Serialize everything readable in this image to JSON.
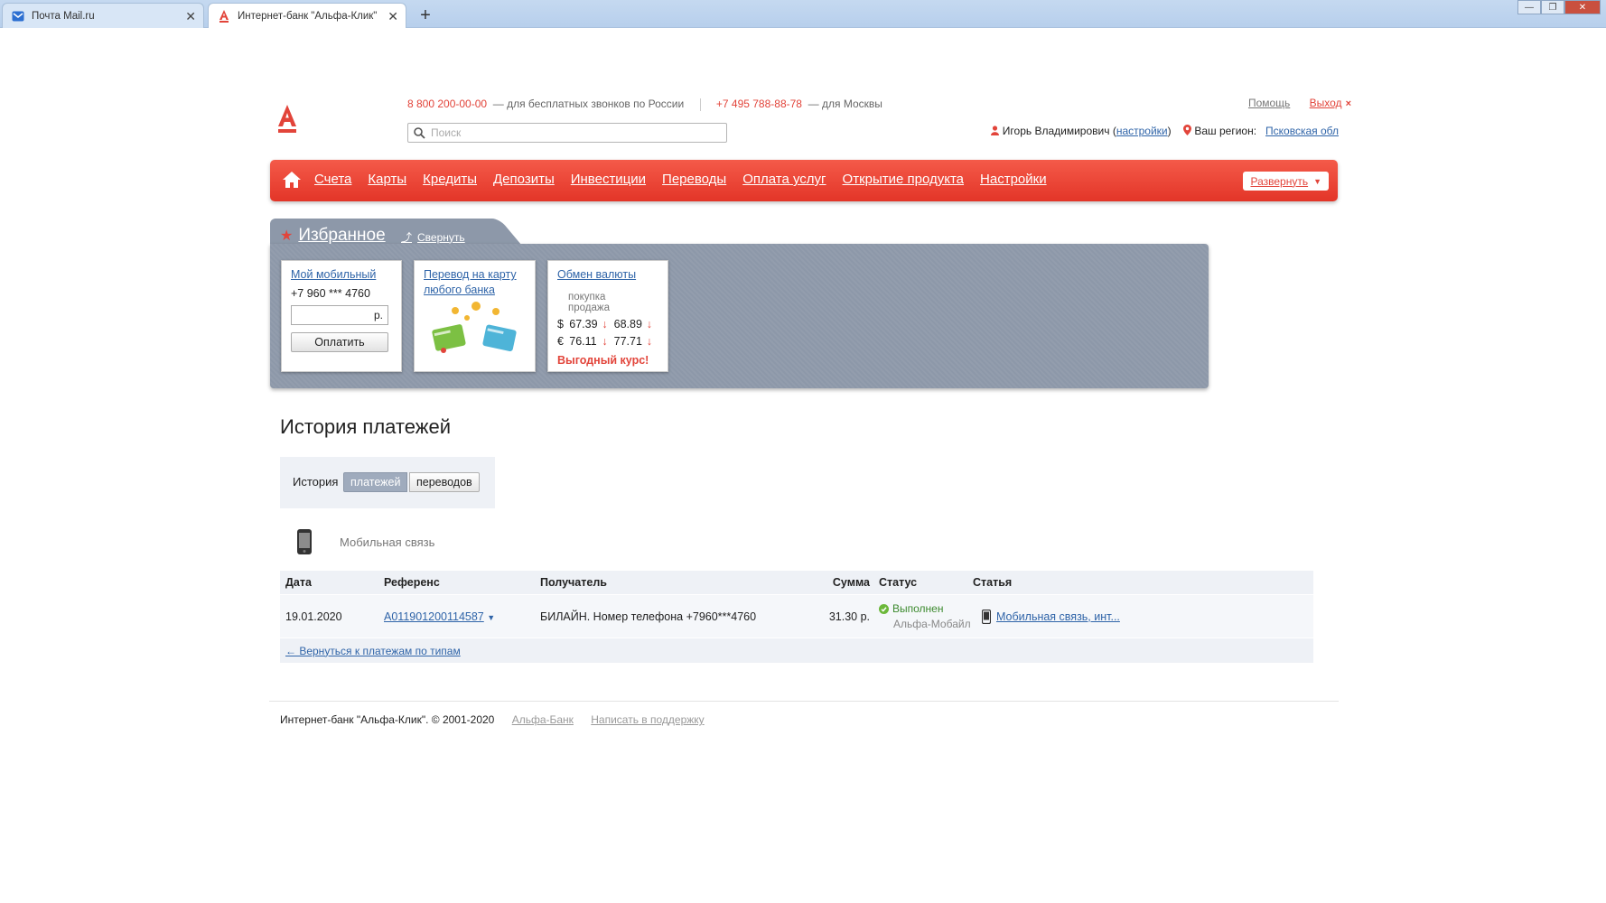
{
  "browser": {
    "tabs": [
      {
        "title": "Почта Mail.ru",
        "active": false
      },
      {
        "title": "Интернет-банк \"Альфа-Клик\"",
        "active": true
      }
    ]
  },
  "header": {
    "phone1": "8 800 200-00-00",
    "phone1_desc": "— для бесплатных звонков по России",
    "phone2": "+7 495 788-88-78",
    "phone2_desc": "— для Москвы",
    "search_placeholder": "Поиск",
    "help": "Помощь",
    "exit": "Выход",
    "user_name": "Игорь Владимирович",
    "settings_link": "настройки",
    "region_label": "Ваш регион:",
    "region_value": "Псковская обл"
  },
  "nav": {
    "items": [
      "Счета",
      "Карты",
      "Кредиты",
      "Депозиты",
      "Инвестиции",
      "Переводы",
      "Оплата услуг",
      "Открытие продукта",
      "Настройки"
    ],
    "expand": "Развернуть"
  },
  "favorites": {
    "title": "Избранное",
    "collapse": "Свернуть",
    "mobile": {
      "title": "Мой мобильный",
      "number": "+7 960 *** 4760",
      "currency": "р.",
      "pay_button": "Оплатить"
    },
    "transfer": {
      "title_line1": "Перевод на карту",
      "title_line2": "любого банка"
    },
    "fx": {
      "title": "Обмен валюты",
      "buy": "покупка",
      "sell": "продажа",
      "usd_sym": "$",
      "usd_buy": "67.39",
      "usd_sell": "68.89",
      "eur_sym": "€",
      "eur_buy": "76.11",
      "eur_sell": "77.71",
      "best": "Выгодный курс!"
    }
  },
  "history": {
    "title": "История платежей",
    "toggle_label": "История",
    "toggle_payments": "платежей",
    "toggle_transfers": "переводов",
    "category": "Мобильная связь",
    "columns": [
      "Дата",
      "Референс",
      "Получатель",
      "Сумма",
      "Статус",
      "Статья"
    ],
    "row": {
      "date": "19.01.2020",
      "reference": "A011901200114587",
      "recipient": "БИЛАЙН. Номер телефона +7960***4760",
      "amount": "31.30 р.",
      "status": "Выполнен",
      "status_source": "Альфа-Мобайл",
      "article": "Мобильная связь, инт..."
    },
    "back_link": "← Вернуться к платежам по типам"
  },
  "footer": {
    "copyright": "Интернет-банк \"Альфа-Клик\". © 2001-2020",
    "link1": "Альфа-Банк",
    "link2": "Написать в поддержку"
  },
  "colors": {
    "brand_red": "#e2443a",
    "link_blue": "#2f64a8",
    "panel_gray": "#8d98a9"
  }
}
